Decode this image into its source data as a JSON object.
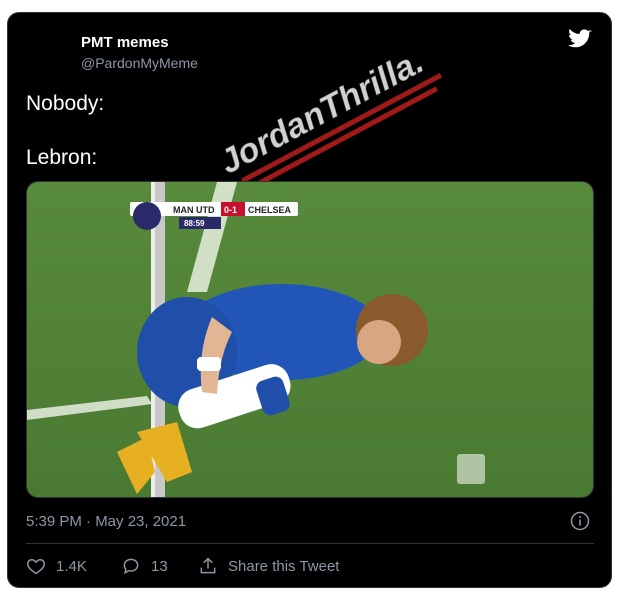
{
  "tweet": {
    "display_name": "PMT memes",
    "handle": "@PardonMyMeme",
    "text_lines": [
      "Nobody:",
      "Lebron:"
    ],
    "timestamp": "5:39 PM · May 23, 2021"
  },
  "watermark": {
    "text": "JordanThrilla."
  },
  "media": {
    "scoreboard": {
      "home": "MAN UTD",
      "score": "0-1",
      "away": "CHELSEA",
      "clock": "88:59"
    }
  },
  "actions": {
    "likes": "1.4K",
    "replies": "13",
    "share_label": "Share this Tweet"
  },
  "colors": {
    "background": "#000000",
    "text": "#ffffff",
    "secondary": "#8b98a5",
    "border": "#2f3336",
    "pitch": "#4f7f36"
  },
  "icons": [
    "twitter-bird-icon",
    "heart-icon",
    "reply-icon",
    "share-icon",
    "info-icon"
  ]
}
